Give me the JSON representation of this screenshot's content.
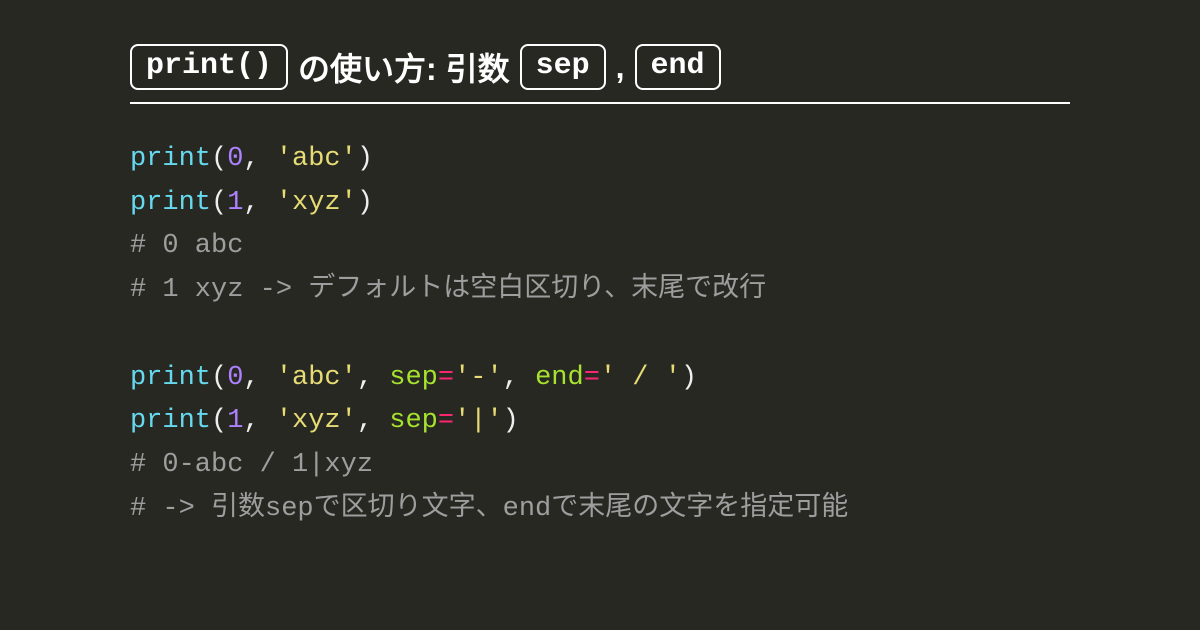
{
  "title": {
    "box1": "print()",
    "t1": "の使い方: 引数",
    "box2": "sep",
    "comma": ",",
    "box3": "end"
  },
  "code": {
    "print": "print",
    "lp": "(",
    "rp": ")",
    "comma": ", ",
    "eq": "=",
    "n0": "0",
    "n1": "1",
    "s_abc": "'abc'",
    "s_xyz": "'xyz'",
    "s_dash": "'-'",
    "s_slash": "' / '",
    "s_pipe": "'|'",
    "kw_sep": "sep",
    "kw_end": "end",
    "c1": "# 0 abc",
    "c2": "# 1 xyz -> デフォルトは空白区切り、末尾で改行",
    "c3": "# 0-abc / 1|xyz",
    "c4": "# -> 引数sepで区切り文字、endで末尾の文字を指定可能"
  }
}
